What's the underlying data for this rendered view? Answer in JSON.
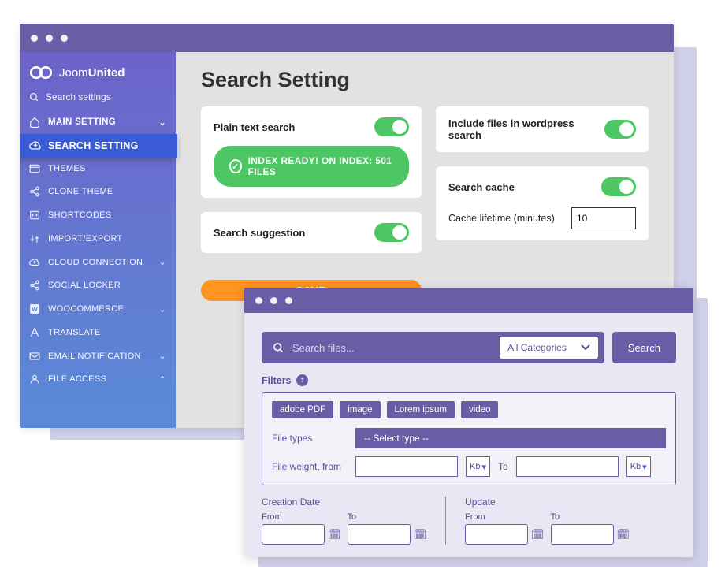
{
  "brand": {
    "prefix": "Joom",
    "suffix": "United"
  },
  "sidebar": {
    "search_placeholder": "Search settings",
    "items": [
      {
        "label": "MAIN SETTING",
        "icon": "home",
        "chevron": "down",
        "head": true
      },
      {
        "label": "SEARCH SETTING",
        "icon": "cloud-up",
        "active": true
      },
      {
        "label": "THEMES",
        "icon": "layout"
      },
      {
        "label": "CLONE THEME",
        "icon": "share"
      },
      {
        "label": "SHORTCODES",
        "icon": "code"
      },
      {
        "label": "IMPORT/EXPORT",
        "icon": "transfer"
      },
      {
        "label": "CLOUD CONNECTION",
        "icon": "cloud-up",
        "chevron": "down"
      },
      {
        "label": "SOCIAL LOCKER",
        "icon": "share"
      },
      {
        "label": "WOOCOMMERCE",
        "icon": "w-square",
        "chevron": "down"
      },
      {
        "label": "TRANSLATE",
        "icon": "translate"
      },
      {
        "label": "EMAIL NOTIFICATION",
        "icon": "mail",
        "chevron": "down"
      },
      {
        "label": "FILE ACCESS",
        "icon": "user",
        "chevron": "up"
      }
    ]
  },
  "page": {
    "title": "Search Setting",
    "plain_text_label": "Plain text search",
    "index_badge": "INDEX READY! ON INDEX: 501 FILES",
    "suggestion_label": "Search suggestion",
    "include_files_label": "Include files in wordpress search",
    "cache_label": "Search cache",
    "cache_lifetime_label": "Cache lifetime (minutes)",
    "cache_lifetime_value": "10",
    "save_label": "SAVE"
  },
  "search_panel": {
    "placeholder": "Search files...",
    "category_label": "All Categories",
    "search_btn": "Search",
    "filters_label": "Filters",
    "tags": [
      "adobe PDF",
      "image",
      "Lorem ipsum",
      "video"
    ],
    "file_types_label": "File types",
    "file_types_placeholder": "-- Select type --",
    "file_weight_label": "File weight, from",
    "to_label": "To",
    "unit": "Kb",
    "creation_date_label": "Creation Date",
    "update_label": "Update",
    "from_label": "From"
  }
}
